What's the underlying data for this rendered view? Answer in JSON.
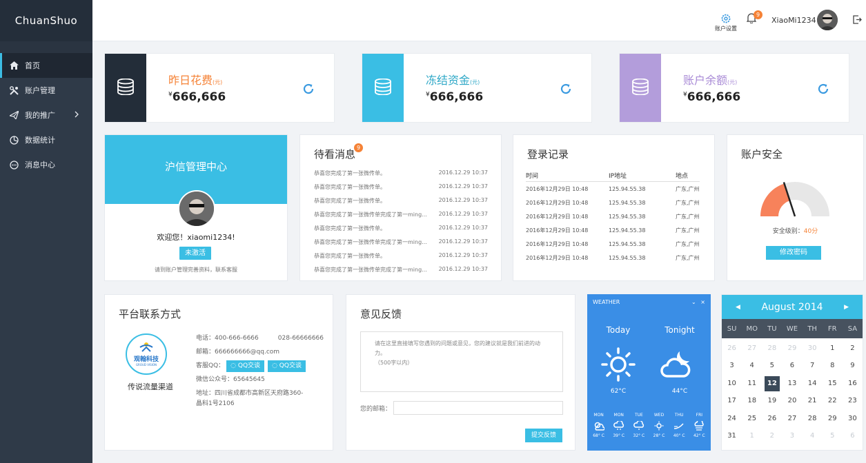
{
  "brand": "ChuanShuo",
  "sidebar": {
    "items": [
      {
        "label": "首页",
        "icon": "home-icon"
      },
      {
        "label": "账户管理",
        "icon": "tools-icon"
      },
      {
        "label": "我的推广",
        "icon": "send-icon"
      },
      {
        "label": "数据统计",
        "icon": "pie-icon"
      },
      {
        "label": "消息中心",
        "icon": "chat-icon"
      }
    ]
  },
  "header": {
    "settings_label": "账户设置",
    "bell_count": "9",
    "username": "XiaoMi1234"
  },
  "stats": [
    {
      "label": "昨日花费",
      "unit": "(元)",
      "currency": "¥",
      "amount": "666,666",
      "color": "#f58236",
      "box_color": "#232d39"
    },
    {
      "label": "冻结资金",
      "unit": "(元)",
      "currency": "¥",
      "amount": "666,666",
      "color": "#2fa8c7",
      "box_color": "#3abee4"
    },
    {
      "label": "账户余额",
      "unit": "(元)",
      "currency": "¥",
      "amount": "666,666",
      "color": "#a98bd6",
      "box_color": "#b39ddb"
    }
  ],
  "profile": {
    "title": "沪信管理中心",
    "welcome": "欢迎您！xiaomi1234!",
    "status_button": "未激活",
    "hint": "请到账户管理完善资料，联系客服"
  },
  "messages": {
    "title": "待看消息",
    "badge": "9",
    "rows": [
      {
        "text": "恭喜您完成了第一张微传单。",
        "time": "2016.12.29 10:37"
      },
      {
        "text": "恭喜您完成了第一张微传单。",
        "time": "2016.12.29 10:37"
      },
      {
        "text": "恭喜您完成了第一张微传单。",
        "time": "2016.12.29 10:37"
      },
      {
        "text": "恭喜您完成了第一张微传单完成了第一ming...",
        "time": "2016.12.29 10:37"
      },
      {
        "text": "恭喜您完成了第一张微传单。",
        "time": "2016.12.29 10:37"
      },
      {
        "text": "恭喜您完成了第一张微传单完成了第一ming...",
        "time": "2016.12.29 10:37"
      },
      {
        "text": "恭喜您完成了第一张微传单。",
        "time": "2016.12.29 10:37"
      },
      {
        "text": "恭喜您完成了第一张微传单完成了第一ming...",
        "time": "2016.12.29 10:37"
      }
    ]
  },
  "login_log": {
    "title": "登录记录",
    "columns": [
      "时间",
      "IP地址",
      "地点"
    ],
    "rows": [
      [
        "2016年12月29日 10:48",
        "125.94.55.38",
        "广东,广州"
      ],
      [
        "2016年12月29日 10:48",
        "125.94.55.38",
        "广东,广州"
      ],
      [
        "2016年12月29日 10:48",
        "125.94.55.38",
        "广东,广州"
      ],
      [
        "2016年12月29日 10:48",
        "125.94.55.38",
        "广东,广州"
      ],
      [
        "2016年12月29日 10:48",
        "125.94.55.38",
        "广东,广州"
      ],
      [
        "2016年12月29日 10:48",
        "125.94.55.38",
        "广东,广州"
      ]
    ]
  },
  "security": {
    "title": "账户安全",
    "level_label": "安全级别：",
    "level_value": "40分",
    "level_fraction": 0.4,
    "change_pwd": "修改密码"
  },
  "contact": {
    "title": "平台联系方式",
    "logo_text": "观翰科技",
    "logo_sub": "GROUD VISION",
    "brand": "传说流量渠道",
    "phone_label": "电话：400-666-6666",
    "phone2": "028-66666666",
    "email": "邮箱：666666666@qq.com",
    "qq_label": "客服QQ：",
    "qq_button": "QQ交谈",
    "wechat": "微信公众号：65645645",
    "address_line1": "地址：四川省成都市高新区天府路360-",
    "address_line2": "晶科1号2106"
  },
  "feedback": {
    "title": "意见反馈",
    "placeholder_line1": "请在这里直接填写您遇到的问题或意见，您的建议就是我们前进的动力。",
    "placeholder_line2": "（500字以内）",
    "email_label": "您的邮箱：",
    "submit": "提交反馈"
  },
  "weather": {
    "header": "WEATHER",
    "today_label": "Today",
    "tonight_label": "Tonight",
    "today_temp": "62°C",
    "tonight_temp": "44°C",
    "days": [
      {
        "name": "MON",
        "temp": "68° C"
      },
      {
        "name": "MON",
        "temp": "39° C"
      },
      {
        "name": "TUE",
        "temp": "32° C"
      },
      {
        "name": "WED",
        "temp": "28° C"
      },
      {
        "name": "THU",
        "temp": "40° C"
      },
      {
        "name": "FRI",
        "temp": "42° C"
      }
    ]
  },
  "calendar": {
    "title": "August 2014",
    "weekdays": [
      "SU",
      "MO",
      "TU",
      "WE",
      "TH",
      "FR",
      "SA"
    ],
    "days": [
      {
        "d": "26",
        "o": true
      },
      {
        "d": "27",
        "o": true
      },
      {
        "d": "28",
        "o": true
      },
      {
        "d": "29",
        "o": true
      },
      {
        "d": "30",
        "o": true
      },
      {
        "d": "1"
      },
      {
        "d": "2"
      },
      {
        "d": "3"
      },
      {
        "d": "4"
      },
      {
        "d": "5"
      },
      {
        "d": "6"
      },
      {
        "d": "7"
      },
      {
        "d": "8"
      },
      {
        "d": "9"
      },
      {
        "d": "10"
      },
      {
        "d": "11"
      },
      {
        "d": "12",
        "today": true
      },
      {
        "d": "13"
      },
      {
        "d": "14"
      },
      {
        "d": "15"
      },
      {
        "d": "16"
      },
      {
        "d": "17"
      },
      {
        "d": "18"
      },
      {
        "d": "19"
      },
      {
        "d": "20"
      },
      {
        "d": "21"
      },
      {
        "d": "22"
      },
      {
        "d": "23"
      },
      {
        "d": "24"
      },
      {
        "d": "25"
      },
      {
        "d": "26"
      },
      {
        "d": "27"
      },
      {
        "d": "28"
      },
      {
        "d": "29"
      },
      {
        "d": "30"
      },
      {
        "d": "31"
      },
      {
        "d": "1",
        "o": true
      },
      {
        "d": "2",
        "o": true
      },
      {
        "d": "3",
        "o": true
      },
      {
        "d": "4",
        "o": true
      },
      {
        "d": "5",
        "o": true
      },
      {
        "d": "6",
        "o": true
      }
    ]
  }
}
